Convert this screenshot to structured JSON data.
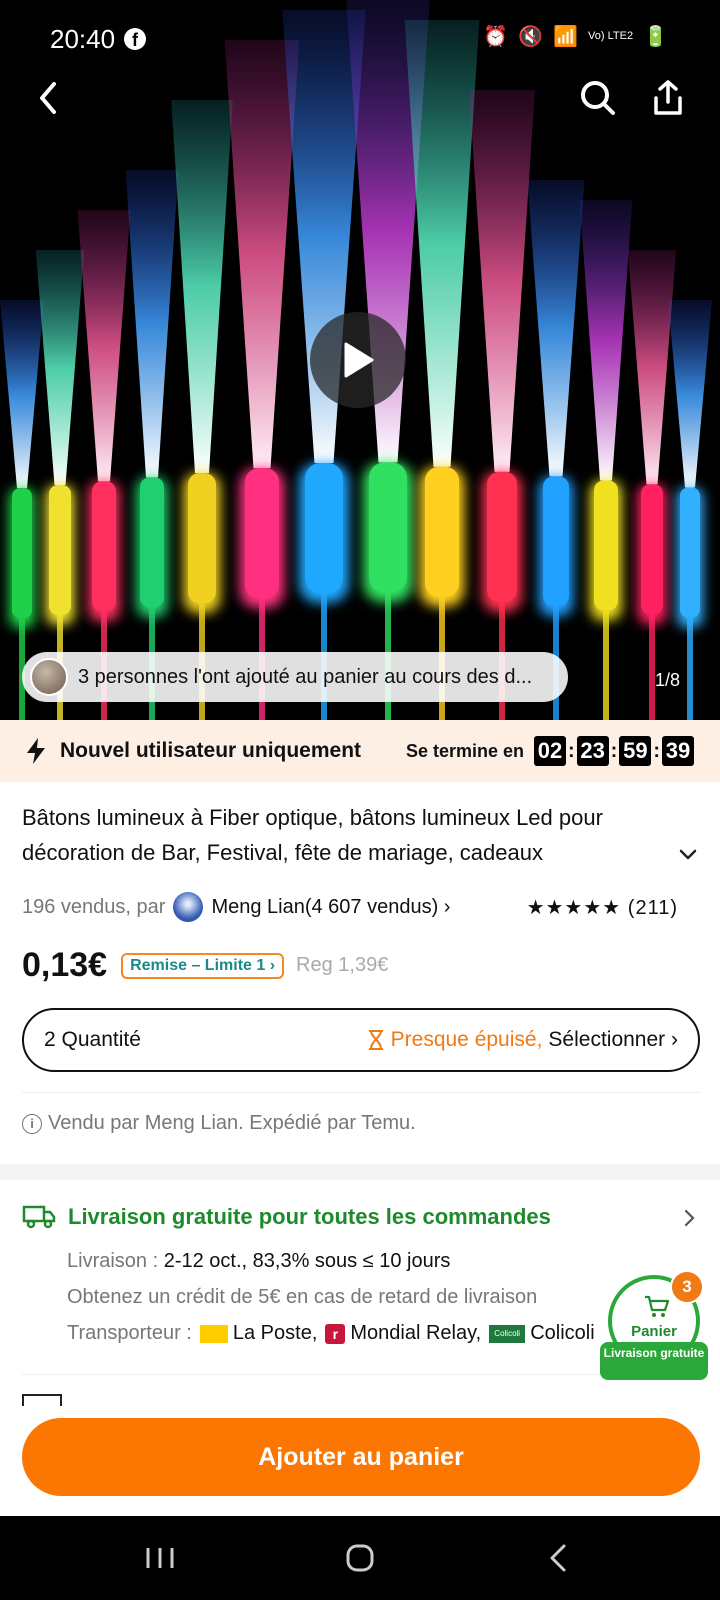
{
  "status_bar": {
    "time": "20:40",
    "network": "Vo) LTE2"
  },
  "hero": {
    "toast_text": "3 personnes l'ont ajouté au panier au cours des d...",
    "page_counter": "1/8"
  },
  "promo": {
    "label": "Nouvel utilisateur uniquement",
    "ends_label": "Se termine en",
    "timer": [
      "02",
      "23",
      "59",
      "39"
    ]
  },
  "product": {
    "title": "Bâtons lumineux à Fiber optique, bâtons lumineux Led pour décoration de Bar, Festival, fête de mariage, cadeaux",
    "sold_count": "196 vendus, par",
    "seller_name": "Meng Lian(4 607 vendus) ›",
    "rating_stars": "★★★★★",
    "rating_count": "(211)",
    "rating_value": 5,
    "price": "0,13€",
    "discount_tag": "Remise – Limite 1 ›",
    "reg_price": "Reg 1,39€",
    "quantity_label": "2 Quantité",
    "stock_warning": "Presque épuisé,",
    "select_label": "Sélectionner ›",
    "sold_by": "Vendu par Meng Lian. Expédié par Temu."
  },
  "shipping": {
    "title": "Livraison gratuite pour toutes les commandes",
    "delivery_label": "Livraison :",
    "delivery_value": "2-12 oct., 83,3% sous ≤ 10 jours",
    "credit_text": "Obtenez un crédit de 5€ en cas de retard de livraison",
    "carrier_label": "Transporteur :",
    "carriers": [
      "La Poste,",
      "Mondial Relay,",
      "Colicoli"
    ],
    "colicoli_logo_text": "Colicoli"
  },
  "cart": {
    "label": "Panier",
    "count": "3",
    "free_ship_tag": "Livraison gratuite"
  },
  "add_to_cart_label": "Ajouter au panier",
  "colors": {
    "accent_orange": "#fb7701",
    "shipping_green": "#1f8a2c",
    "promo_bg": "#fdefe4"
  },
  "icons": [
    "back-icon",
    "search-icon",
    "share-icon",
    "play-icon",
    "bolt-icon",
    "chevron-down-icon",
    "hourglass-icon",
    "info-icon",
    "truck-icon",
    "cart-icon"
  ]
}
